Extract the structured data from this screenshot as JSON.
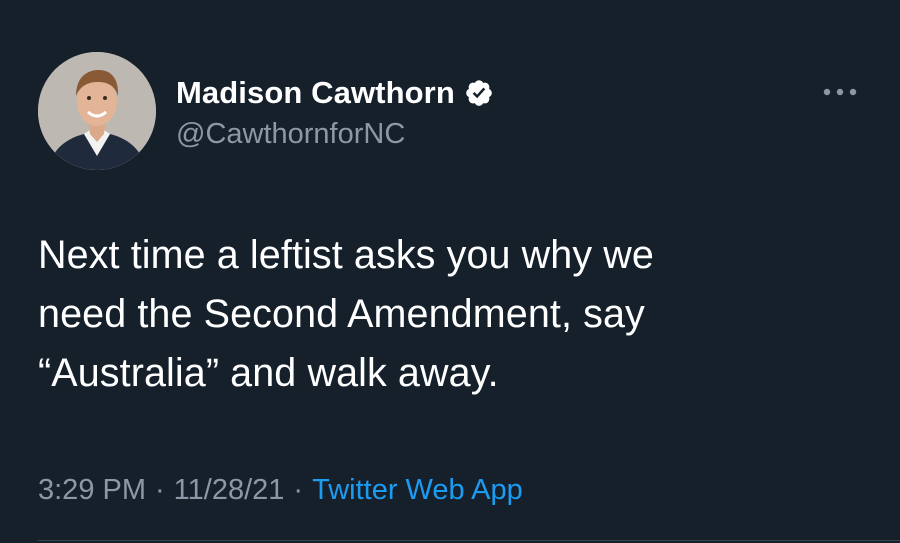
{
  "tweet": {
    "author": {
      "display_name": "Madison Cawthorn",
      "handle": "@CawthornforNC",
      "verified_icon": "verified-badge-icon",
      "avatar_icon": "profile-photo"
    },
    "more_icon": "ellipsis-icon",
    "text_lines": [
      "Next time a leftist asks you why we",
      "need the Second Amendment, say",
      "“Australia” and walk away."
    ],
    "time": "3:29 PM",
    "separator": "·",
    "date": "11/28/21",
    "source": "Twitter Web App"
  },
  "colors": {
    "background": "#15202b",
    "primary_text": "#ffffff",
    "secondary_text": "#8b98a5",
    "link": "#1d9bf0",
    "divider": "#38444d"
  }
}
